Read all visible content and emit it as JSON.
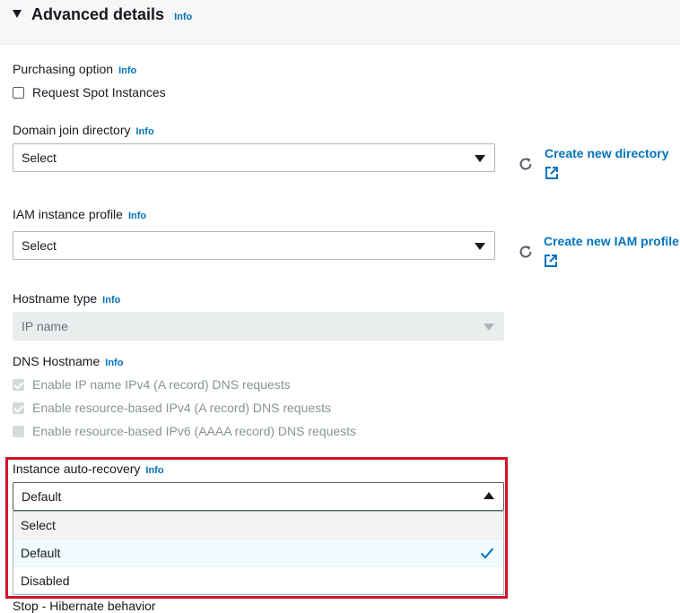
{
  "section": {
    "title": "Advanced details",
    "info": "Info",
    "expand_icon": "caret-down-icon"
  },
  "purchasing": {
    "label": "Purchasing option",
    "info": "Info",
    "checkbox_label": "Request Spot Instances",
    "checked": false
  },
  "domain_join": {
    "label": "Domain join directory",
    "info": "Info",
    "value": "Select",
    "refresh_icon": "refresh-icon",
    "create_link": "Create new directory",
    "external_icon": "external-link-icon"
  },
  "iam_profile": {
    "label": "IAM instance profile",
    "info": "Info",
    "value": "Select",
    "refresh_icon": "refresh-icon",
    "create_link": "Create new IAM profile",
    "external_icon": "external-link-icon"
  },
  "hostname_type": {
    "label": "Hostname type",
    "info": "Info",
    "value": "IP name",
    "disabled": true
  },
  "dns_hostname": {
    "label": "DNS Hostname",
    "info": "Info",
    "options": [
      {
        "label": "Enable IP name IPv4 (A record) DNS requests",
        "checked": true
      },
      {
        "label": "Enable resource-based IPv4 (A record) DNS requests",
        "checked": true
      },
      {
        "label": "Enable resource-based IPv6 (AAAA record) DNS requests",
        "checked": false
      }
    ]
  },
  "auto_recovery": {
    "label": "Instance auto-recovery",
    "info": "Info",
    "value": "Default",
    "options": [
      "Select",
      "Default",
      "Disabled"
    ],
    "selected": "Default"
  },
  "colors": {
    "link": "#0073bb",
    "highlight_border": "#d0132d",
    "selected_option_bg": "#f1faff"
  },
  "truncated_text": "Stop - Hibernate behavior"
}
